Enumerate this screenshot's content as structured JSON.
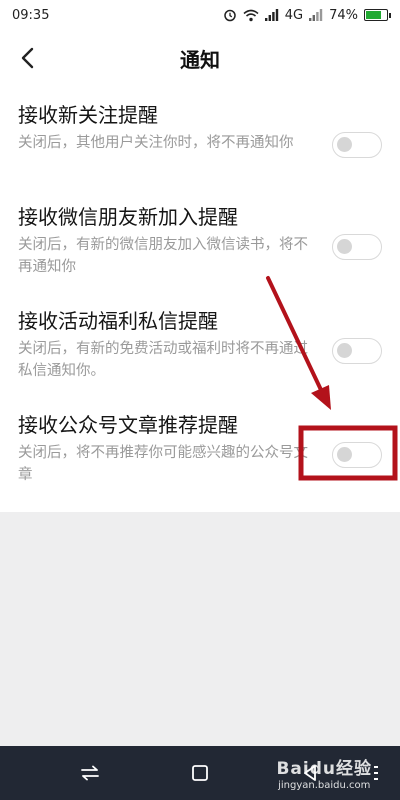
{
  "status_bar": {
    "time": "09:35",
    "network": "4G",
    "battery": "74%",
    "battery_level": 0.74
  },
  "header": {
    "title": "通知",
    "back_icon": "chevron-left-icon"
  },
  "settings": [
    {
      "title": "接收新关注提醒",
      "desc": "关闭后，其他用户关注你时，将不再通知你",
      "enabled": false
    },
    {
      "title": "接收微信朋友新加入提醒",
      "desc": "关闭后，有新的微信朋友加入微信读书，将不再通知你",
      "enabled": false
    },
    {
      "title": "接收活动福利私信提醒",
      "desc": "关闭后，有新的免费活动或福利时将不再通过私信通知你。",
      "enabled": false
    },
    {
      "title": "接收公众号文章推荐提醒",
      "desc": "关闭后，将不再推荐你可能感兴趣的公众号文章",
      "enabled": false
    }
  ],
  "nav_bar": {
    "icons": [
      "switch-arrows-icon",
      "home-square-icon",
      "back-triangle-icon",
      "menu-icon"
    ]
  },
  "watermark": {
    "main": "Baidu经验",
    "sub": "jingyan.baidu.com"
  },
  "colors": {
    "annotation": "#b3121b",
    "battery_fill": "#22aa33",
    "nav_bg": "#222834"
  }
}
